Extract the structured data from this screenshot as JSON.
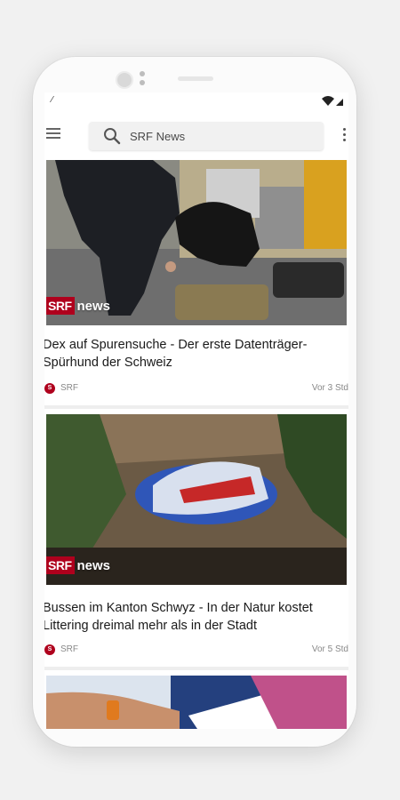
{
  "status": {
    "left_glyph": "⁄"
  },
  "search": {
    "placeholder": "SRF News"
  },
  "articles": [
    {
      "badge_brand": "SRF",
      "badge_label": "news",
      "title": "Dex auf Spurensuche - Der erste Datenträger-Spürhund der Schweiz",
      "source": "SRF",
      "time": "Vor 3 Std"
    },
    {
      "badge_brand": "SRF",
      "badge_label": "news",
      "title": "Bussen im Kanton Schwyz - In der Natur kostet Littering dreimal mehr als in der Stadt",
      "source": "SRF",
      "time": "Vor 5 Std"
    }
  ],
  "colors": {
    "brand": "#af001d",
    "background": "#f1f1f1"
  },
  "icons": [
    "menu-icon",
    "search-icon",
    "more-vert-icon",
    "wifi-icon",
    "signal-icon"
  ]
}
